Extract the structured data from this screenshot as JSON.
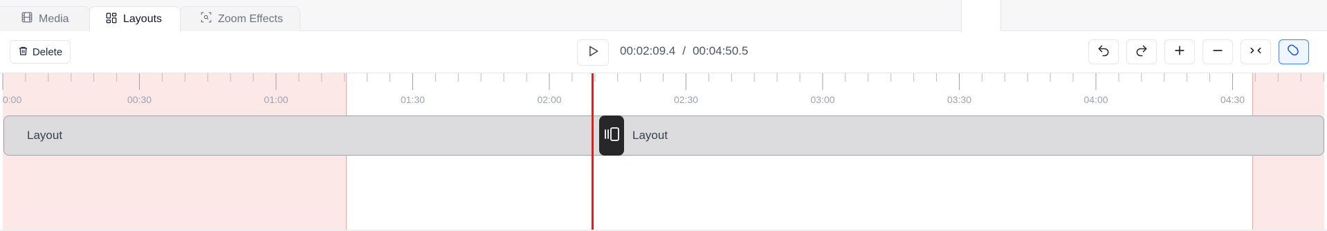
{
  "tabs": [
    {
      "label": "Media",
      "icon": "film-icon"
    },
    {
      "label": "Layouts",
      "icon": "layout-grid-icon",
      "active": true
    },
    {
      "label": "Zoom Effects",
      "icon": "zoom-focus-icon"
    }
  ],
  "toolbar": {
    "delete_label": "Delete",
    "current_time": "00:02:09.4",
    "separator": "/",
    "total_time": "00:04:50.5",
    "buttons": [
      "undo-icon",
      "redo-icon",
      "plus-icon",
      "minus-icon",
      "collapse-icon",
      "magnet-icon"
    ],
    "magnet_active": true
  },
  "timeline": {
    "ruler_labels": [
      "0:00",
      "00:30",
      "01:00",
      "01:30",
      "02:00",
      "02:30",
      "03:00",
      "03:30",
      "04:00",
      "04:30"
    ],
    "clips": [
      {
        "label": "Layout"
      },
      {
        "label": "Layout"
      }
    ],
    "colors": {
      "playhead": "#e11d1d",
      "trim_region": "#fde8e8",
      "clip": "#dcdcde"
    }
  }
}
